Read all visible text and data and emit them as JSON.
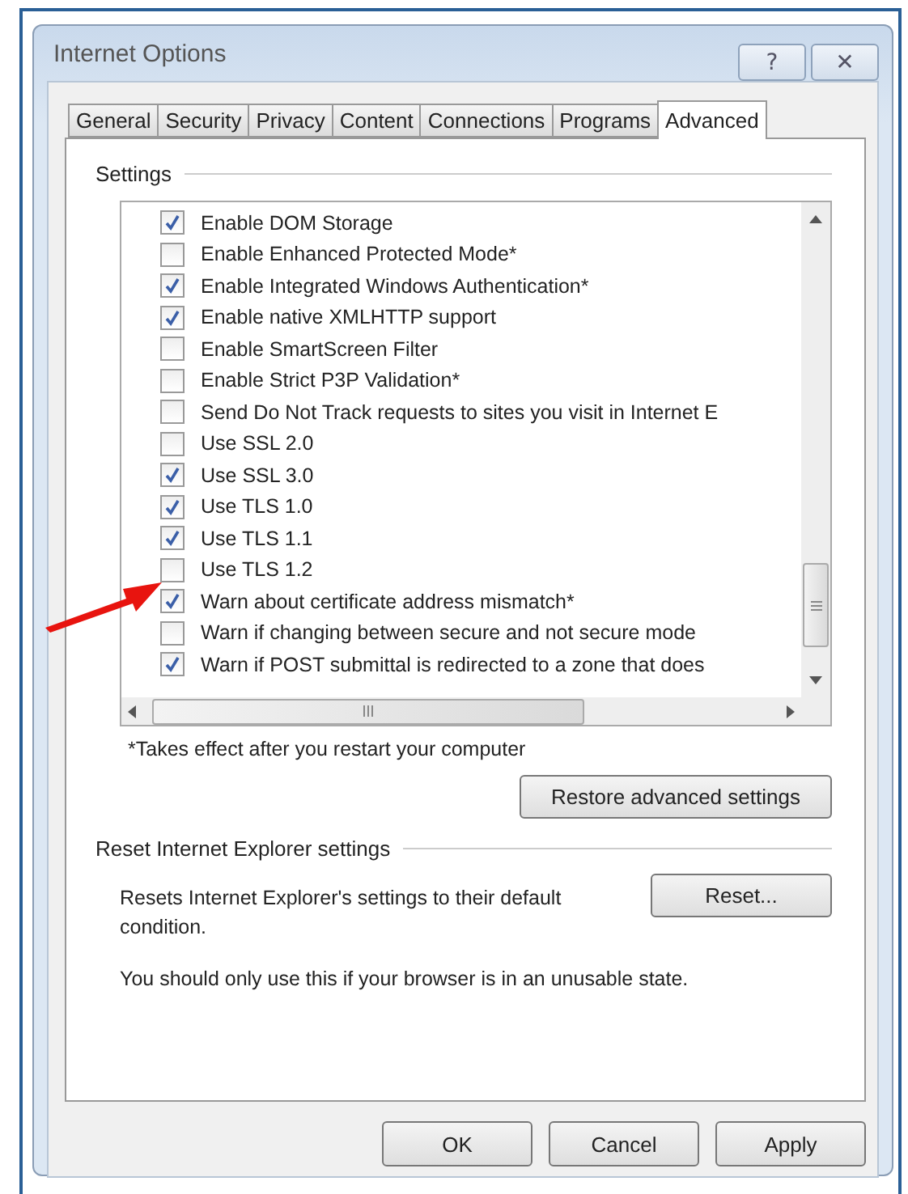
{
  "window": {
    "title": "Internet Options",
    "help_button": "?",
    "close_button": "✕"
  },
  "tabs": [
    {
      "label": "General",
      "selected": false
    },
    {
      "label": "Security",
      "selected": false
    },
    {
      "label": "Privacy",
      "selected": false
    },
    {
      "label": "Content",
      "selected": false
    },
    {
      "label": "Connections",
      "selected": false
    },
    {
      "label": "Programs",
      "selected": false
    },
    {
      "label": "Advanced",
      "selected": true
    }
  ],
  "settings": {
    "heading": "Settings",
    "items": [
      {
        "label": "Enable DOM Storage",
        "checked": true
      },
      {
        "label": "Enable Enhanced Protected Mode*",
        "checked": false
      },
      {
        "label": "Enable Integrated Windows Authentication*",
        "checked": true
      },
      {
        "label": "Enable native XMLHTTP support",
        "checked": true
      },
      {
        "label": "Enable SmartScreen Filter",
        "checked": false
      },
      {
        "label": "Enable Strict P3P Validation*",
        "checked": false
      },
      {
        "label": "Send Do Not Track requests to sites you visit in Internet E",
        "checked": false
      },
      {
        "label": "Use SSL 2.0",
        "checked": false
      },
      {
        "label": "Use SSL 3.0",
        "checked": true
      },
      {
        "label": "Use TLS 1.0",
        "checked": true
      },
      {
        "label": "Use TLS 1.1",
        "checked": true
      },
      {
        "label": "Use TLS 1.2",
        "checked": false
      },
      {
        "label": "Warn about certificate address mismatch*",
        "checked": true
      },
      {
        "label": "Warn if changing between secure and not secure mode",
        "checked": false
      },
      {
        "label": "Warn if POST submittal is redirected to a zone that does",
        "checked": true
      }
    ],
    "note": "*Takes effect after you restart your computer",
    "restore_button": "Restore advanced settings"
  },
  "reset": {
    "heading": "Reset Internet Explorer settings",
    "description": "Resets Internet Explorer's settings to their default condition.",
    "button": "Reset...",
    "warning": "You should only use this if your browser is in an unusable state."
  },
  "buttons": [
    "OK",
    "Cancel",
    "Apply"
  ]
}
